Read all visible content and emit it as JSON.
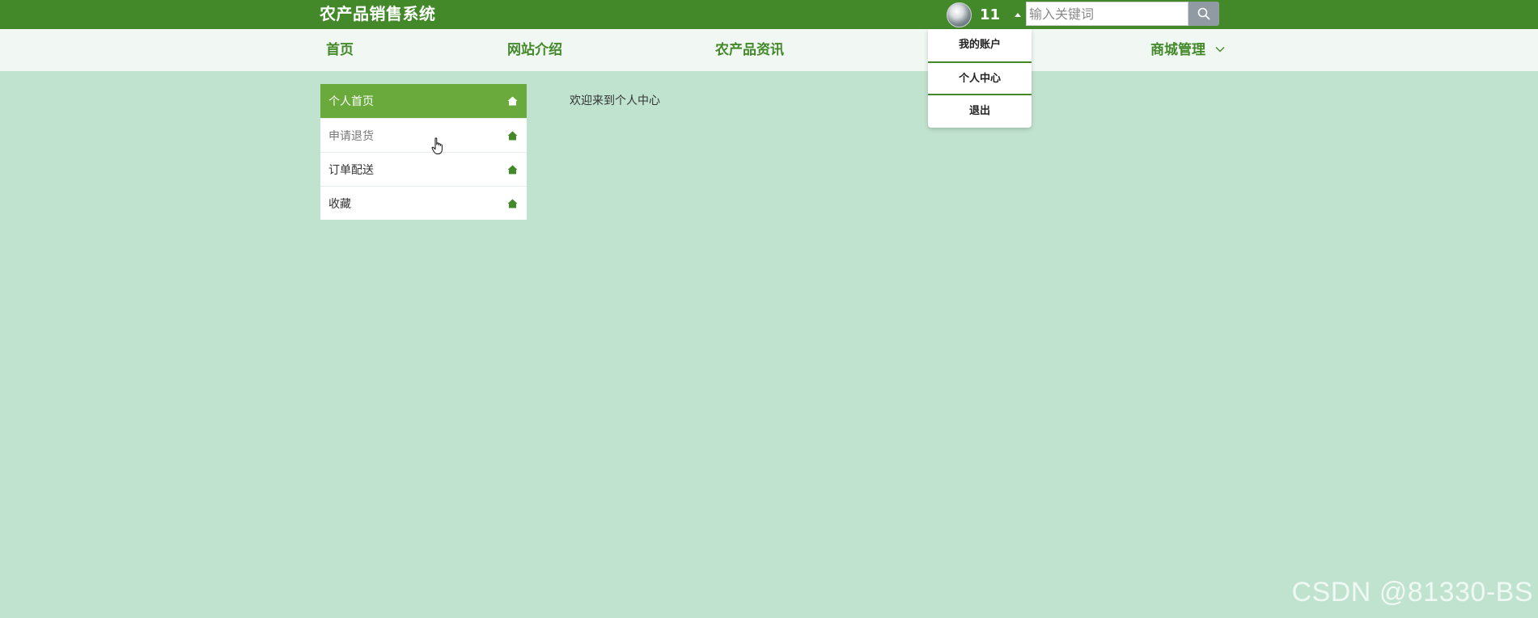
{
  "header": {
    "title": "农产品销售系统",
    "user_name": "11",
    "search": {
      "placeholder": "输入关键词",
      "value": ""
    }
  },
  "nav": {
    "items": [
      {
        "label": "首页"
      },
      {
        "label": "网站介绍"
      },
      {
        "label": "农产品资讯"
      },
      {
        "label": "商城管理"
      }
    ]
  },
  "user_menu": {
    "items": [
      {
        "label": "我的账户"
      },
      {
        "label": "个人中心"
      },
      {
        "label": "退出"
      }
    ]
  },
  "sidebar": {
    "items": [
      {
        "label": "个人首页",
        "active": true
      },
      {
        "label": "申请退货",
        "active": false
      },
      {
        "label": "订单配送",
        "active": false
      },
      {
        "label": "收藏",
        "active": false
      }
    ]
  },
  "main": {
    "welcome_text": "欢迎来到个人中心"
  },
  "watermark": "CSDN @81330-BS",
  "icons": {
    "avatar": "avatar-image",
    "caret": "caret-up-icon",
    "search": "search-icon",
    "nav_chevron": "chevron-down-icon",
    "sidebar": "home-icon"
  },
  "colors": {
    "brand_green": "#43892a",
    "active_green": "#6aaa3c",
    "page_background": "#c0e3cf",
    "nav_background": "#f1f8f4",
    "search_button": "#8f9aa3"
  }
}
